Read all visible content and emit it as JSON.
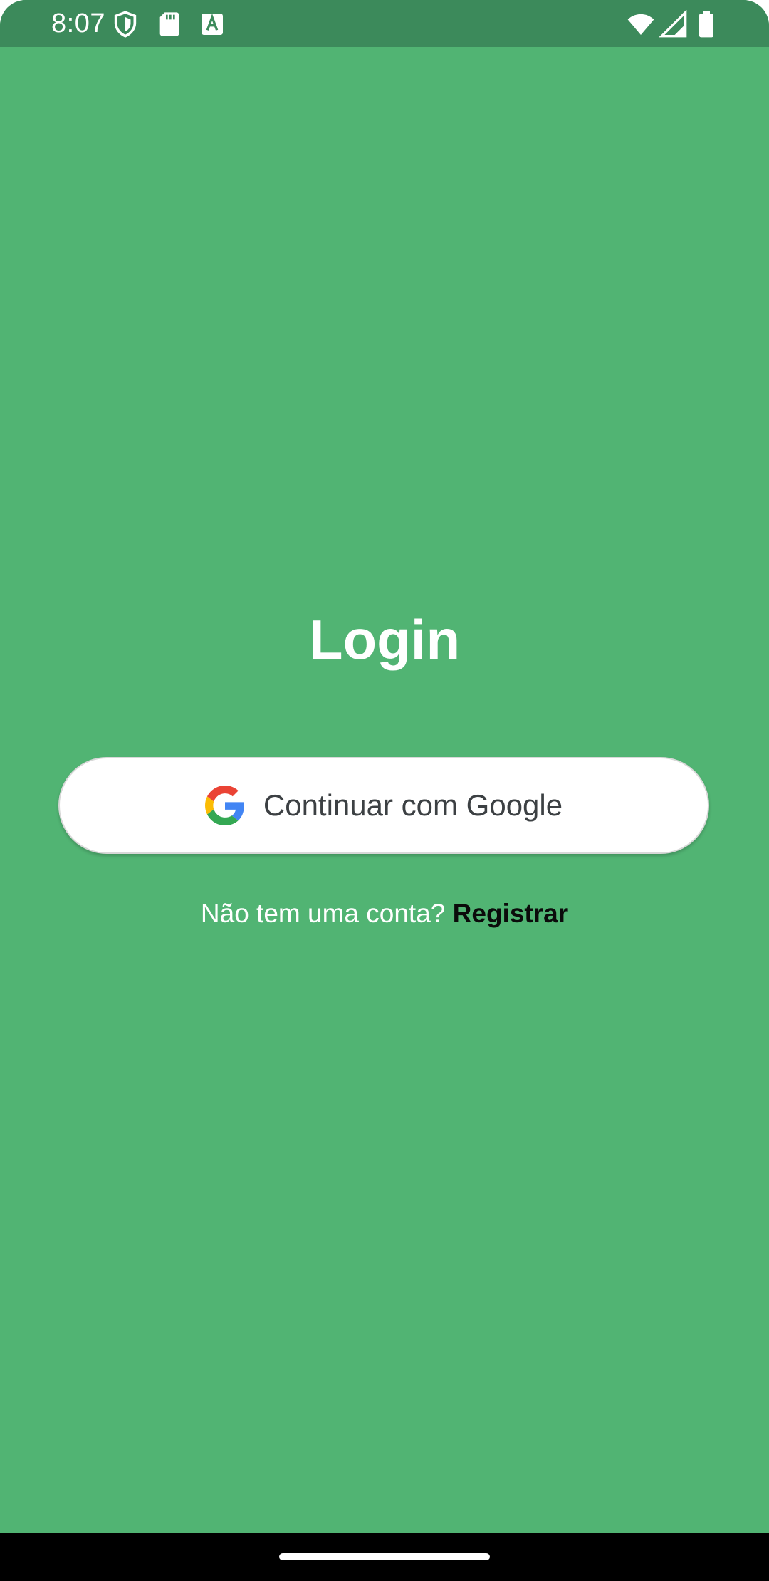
{
  "status_bar": {
    "time": "8:07",
    "icons": [
      "shield-icon",
      "sd-card-icon",
      "keyboard-a-icon",
      "wifi-icon",
      "signal-icon",
      "battery-icon"
    ]
  },
  "login": {
    "title": "Login",
    "google_button_label": "Continuar com Google",
    "register_question": "Não tem uma conta?",
    "register_link": "Registrar"
  },
  "colors": {
    "background": "#51b473",
    "status_bar": "#3c8a5b",
    "button": "#ffffff",
    "link": "#0b0b0b"
  }
}
